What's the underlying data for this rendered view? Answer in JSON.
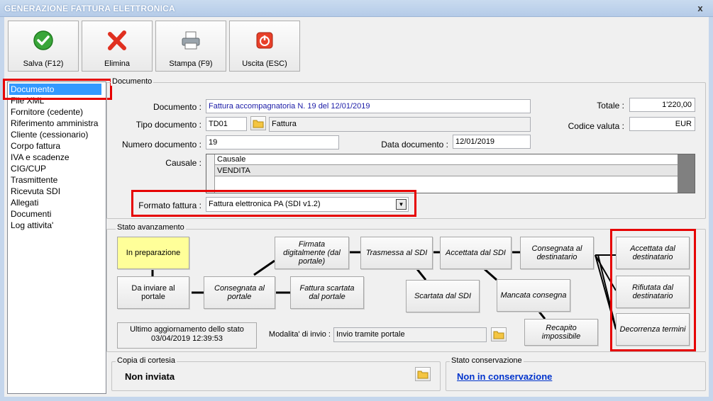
{
  "window": {
    "title": "GENERAZIONE FATTURA ELETTRONICA",
    "close_glyph": "x"
  },
  "toolbar": {
    "save_label": "Salva (F12)",
    "delete_label": "Elimina",
    "print_label": "Stampa (F9)",
    "exit_label": "Uscita (ESC)"
  },
  "sidebar": {
    "items": [
      "Documento",
      "File XML",
      "Fornitore (cedente)",
      "Riferimento amministra",
      "Cliente (cessionario)",
      "Corpo fattura",
      "IVA e scadenze",
      "CIG/CUP",
      "Trasmittente",
      "Ricevuta SDI",
      "Allegati",
      "Documenti",
      "Log attivita'"
    ]
  },
  "documento": {
    "group_title": "Documento",
    "documento_label": "Documento :",
    "documento_value": "Fattura accompagnatoria N. 19 del 12/01/2019",
    "tipo_label": "Tipo documento :",
    "tipo_code": "TD01",
    "tipo_desc": "Fattura",
    "numero_label": "Numero documento :",
    "numero_value": "19",
    "data_label": "Data documento :",
    "data_value": "12/01/2019",
    "totale_label": "Totale :",
    "totale_value": "1'220,00",
    "valuta_label": "Codice valuta :",
    "valuta_value": "EUR",
    "causale_label": "Causale :",
    "causale_header": "Causale",
    "causale_row": "VENDITA",
    "formato_label": "Formato fattura :",
    "formato_value": "Fattura elettronica PA (SDI v1.2)"
  },
  "stato": {
    "group_title": "Stato avanzamento",
    "nodes": {
      "in_preparazione": "In preparazione",
      "da_inviare": "Da inviare al portale",
      "consegnata_portale": "Consegnata al portale",
      "firmata": "Firmata digitalmente (dal portale)",
      "scartata_portale": "Fattura scartata dal portale",
      "trasmessa": "Trasmessa al SDI",
      "scartata_sdi": "Scartata dal SDI",
      "accettata_sdi": "Accettata dal SDI",
      "mancata": "Mancata consegna",
      "consegnata_dest": "Consegnata al destinatario",
      "recapito": "Recapito impossibile",
      "accettata_dest": "Accettata dal destinatario",
      "rifiutata_dest": "Rifiutata dal destinatario",
      "decorrenza": "Decorrenza termini"
    },
    "ultimo_label": "Ultimo aggiornamento dello stato",
    "ultimo_value": "03/04/2019 12:39:53",
    "modalita_label": "Modalita' di invio :",
    "modalita_value": "Invio tramite portale"
  },
  "copia": {
    "group_title": "Copia di cortesia",
    "value": "Non inviata"
  },
  "conservazione": {
    "group_title": "Stato conservazione",
    "value": "Non in conservazione"
  },
  "colors": {
    "highlight_red": "#e60000",
    "selection_blue": "#3399ff",
    "link_blue": "#0033cc",
    "node_yellow": "#ffff99"
  }
}
